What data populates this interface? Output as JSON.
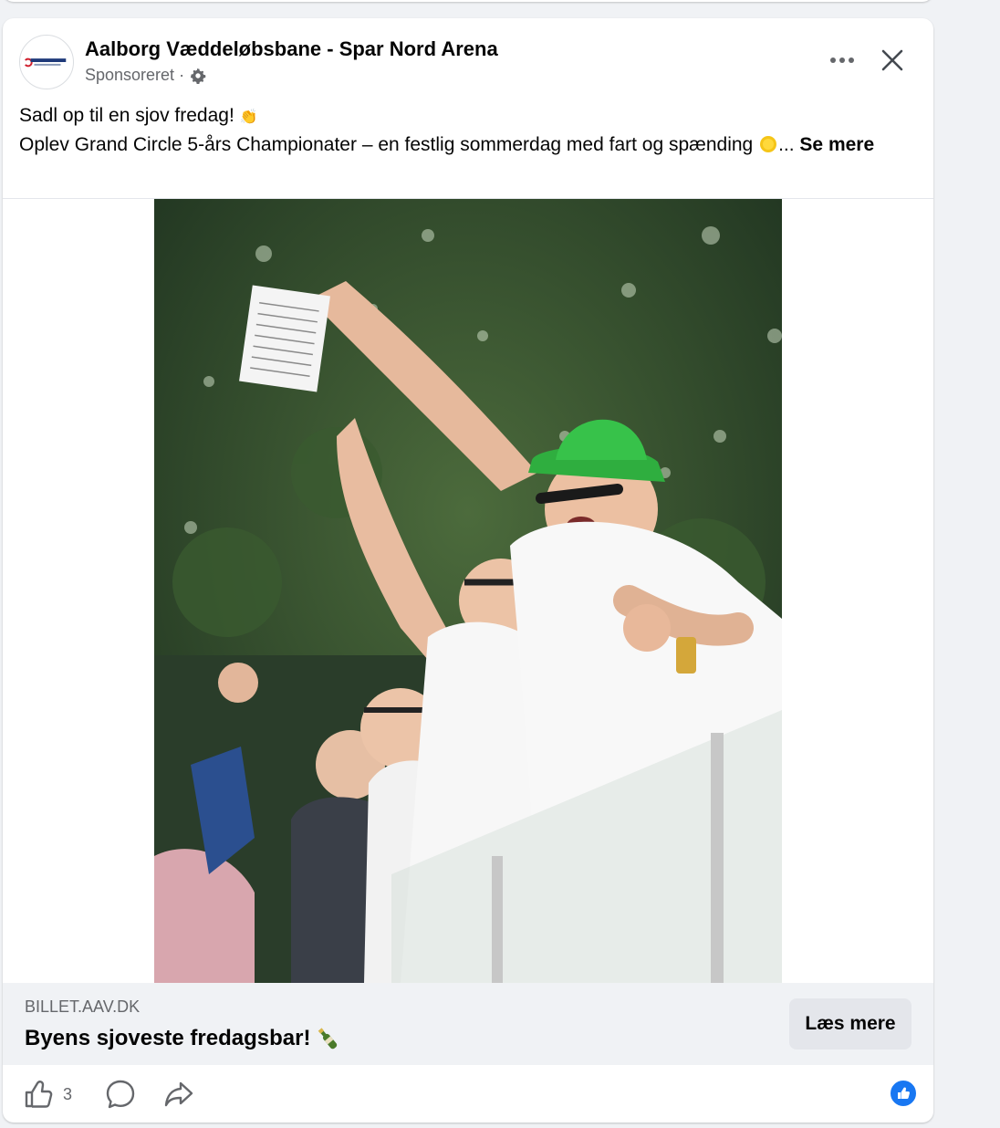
{
  "post": {
    "page_name": "Aalborg Væddeløbsbane - Spar Nord Arena",
    "sponsored": "Sponsoreret",
    "separator": "·",
    "avatar_text": "Spar Nord Arena",
    "line1": "Sadl op til en sjov fredag! ",
    "line1_emoji": "👏",
    "line2": "Oplev Grand Circle 5-års Championater – en festlig sommerdag med fart og spænding ",
    "line2_emoji": "☀",
    "ellipsis": "...",
    "see_more": "Se mere",
    "photo_icon": "racegoers-cheering-photo"
  },
  "link": {
    "domain": "BILLET.AAV.DK",
    "headline": "Byens sjoveste fredagsbar! ",
    "headline_emoji": "🍾",
    "cta": "Læs mere"
  },
  "actions": {
    "like_count": "3",
    "icons": [
      "thumbs-up-icon",
      "comment-icon",
      "share-icon",
      "like-reaction-icon"
    ]
  },
  "colors": {
    "accent": "#1877f2",
    "secondary_text": "#65676b",
    "hat_green": "#2fae3f"
  }
}
